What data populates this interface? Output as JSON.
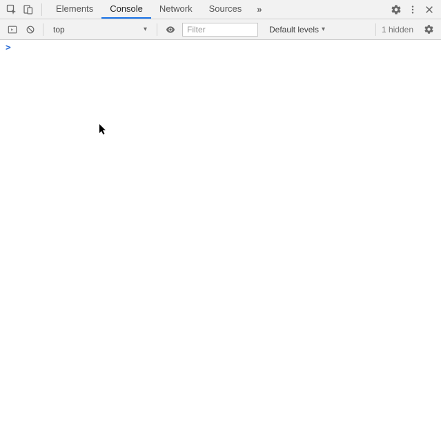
{
  "tabs": {
    "elements": "Elements",
    "console": "Console",
    "network": "Network",
    "sources": "Sources",
    "more": "»"
  },
  "toolbar": {
    "context": {
      "selected": "top",
      "caret": "▾"
    },
    "filter_placeholder": "Filter",
    "levels_label": "Default levels",
    "levels_caret": "▾",
    "hidden_label": "1 hidden"
  },
  "console": {
    "prompt": ">"
  },
  "icons": {
    "inspect": "inspect",
    "device": "device",
    "settings": "settings",
    "kebab": "kebab",
    "close": "close",
    "exec": "exec",
    "clear": "clear",
    "visibility": "visibility",
    "gear_small": "gear"
  }
}
